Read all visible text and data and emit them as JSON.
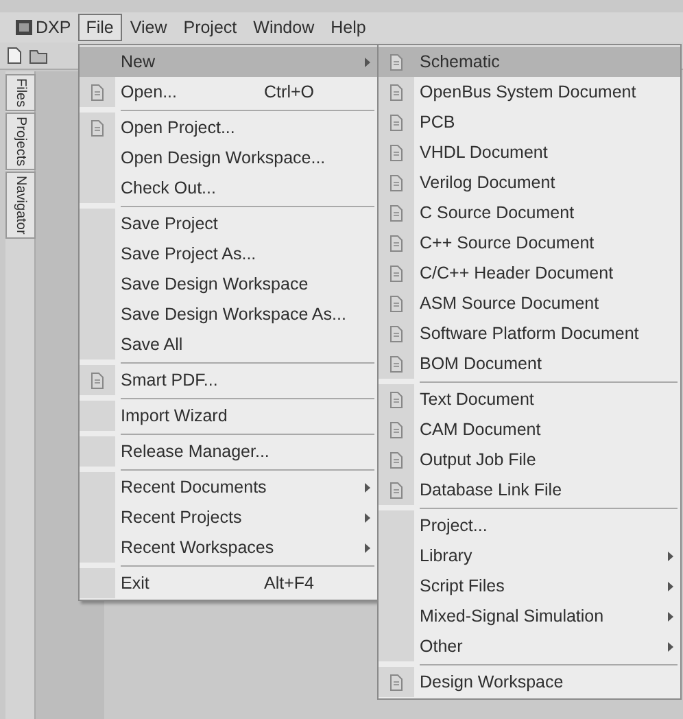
{
  "menu_bar": [
    {
      "label": "DXP",
      "kind": "logo",
      "selected": false
    },
    {
      "label": "File",
      "kind": "menu",
      "selected": true
    },
    {
      "label": "View",
      "kind": "menu",
      "selected": false
    },
    {
      "label": "Project",
      "kind": "menu",
      "selected": false
    },
    {
      "label": "Window",
      "kind": "menu",
      "selected": false
    },
    {
      "label": "Help",
      "kind": "menu",
      "selected": false
    }
  ],
  "side_tabs": [
    "Files",
    "Projects",
    "Navigator"
  ],
  "file_menu": [
    {
      "kind": "item",
      "label": "New",
      "icon": false,
      "submenu": true,
      "selected": true
    },
    {
      "kind": "item",
      "label": "Open...",
      "icon": true,
      "shortcut": "Ctrl+O",
      "submenu": false,
      "selected": false
    },
    {
      "kind": "separator"
    },
    {
      "kind": "item",
      "label": "Open Project...",
      "icon": true,
      "submenu": false,
      "selected": false
    },
    {
      "kind": "item",
      "label": "Open Design Workspace...",
      "icon": false,
      "submenu": false,
      "selected": false
    },
    {
      "kind": "item",
      "label": "Check Out...",
      "icon": false,
      "submenu": false,
      "selected": false
    },
    {
      "kind": "separator"
    },
    {
      "kind": "item",
      "label": "Save Project",
      "icon": false,
      "submenu": false,
      "selected": false
    },
    {
      "kind": "item",
      "label": "Save Project As...",
      "icon": false,
      "submenu": false,
      "selected": false
    },
    {
      "kind": "item",
      "label": "Save Design Workspace",
      "icon": false,
      "submenu": false,
      "selected": false
    },
    {
      "kind": "item",
      "label": "Save Design Workspace As...",
      "icon": false,
      "submenu": false,
      "selected": false
    },
    {
      "kind": "item",
      "label": "Save All",
      "icon": false,
      "submenu": false,
      "selected": false
    },
    {
      "kind": "separator"
    },
    {
      "kind": "item",
      "label": "Smart PDF...",
      "icon": true,
      "submenu": false,
      "selected": false
    },
    {
      "kind": "separator"
    },
    {
      "kind": "item",
      "label": "Import Wizard",
      "icon": false,
      "submenu": false,
      "selected": false
    },
    {
      "kind": "separator"
    },
    {
      "kind": "item",
      "label": "Release Manager...",
      "icon": false,
      "submenu": false,
      "selected": false
    },
    {
      "kind": "separator"
    },
    {
      "kind": "item",
      "label": "Recent Documents",
      "icon": false,
      "submenu": true,
      "selected": false
    },
    {
      "kind": "item",
      "label": "Recent Projects",
      "icon": false,
      "submenu": true,
      "selected": false
    },
    {
      "kind": "item",
      "label": "Recent Workspaces",
      "icon": false,
      "submenu": true,
      "selected": false
    },
    {
      "kind": "separator"
    },
    {
      "kind": "item",
      "label": "Exit",
      "icon": false,
      "shortcut": "Alt+F4",
      "submenu": false,
      "selected": false
    }
  ],
  "new_submenu": [
    {
      "kind": "item",
      "label": "Schematic",
      "icon": true,
      "submenu": false,
      "selected": true
    },
    {
      "kind": "item",
      "label": "OpenBus System Document",
      "icon": true,
      "submenu": false,
      "selected": false
    },
    {
      "kind": "item",
      "label": "PCB",
      "icon": true,
      "submenu": false,
      "selected": false
    },
    {
      "kind": "item",
      "label": "VHDL Document",
      "icon": true,
      "submenu": false,
      "selected": false
    },
    {
      "kind": "item",
      "label": "Verilog Document",
      "icon": true,
      "submenu": false,
      "selected": false
    },
    {
      "kind": "item",
      "label": "C Source Document",
      "icon": true,
      "submenu": false,
      "selected": false
    },
    {
      "kind": "item",
      "label": "C++ Source Document",
      "icon": true,
      "submenu": false,
      "selected": false
    },
    {
      "kind": "item",
      "label": "C/C++ Header Document",
      "icon": true,
      "submenu": false,
      "selected": false
    },
    {
      "kind": "item",
      "label": "ASM Source Document",
      "icon": true,
      "submenu": false,
      "selected": false
    },
    {
      "kind": "item",
      "label": "Software Platform Document",
      "icon": true,
      "submenu": false,
      "selected": false
    },
    {
      "kind": "item",
      "label": "BOM Document",
      "icon": true,
      "submenu": false,
      "selected": false
    },
    {
      "kind": "separator"
    },
    {
      "kind": "item",
      "label": "Text Document",
      "icon": true,
      "submenu": false,
      "selected": false
    },
    {
      "kind": "item",
      "label": "CAM Document",
      "icon": true,
      "submenu": false,
      "selected": false
    },
    {
      "kind": "item",
      "label": "Output Job File",
      "icon": true,
      "submenu": false,
      "selected": false
    },
    {
      "kind": "item",
      "label": "Database Link File",
      "icon": true,
      "submenu": false,
      "selected": false
    },
    {
      "kind": "separator"
    },
    {
      "kind": "item",
      "label": "Project...",
      "icon": false,
      "submenu": false,
      "selected": false
    },
    {
      "kind": "item",
      "label": "Library",
      "icon": false,
      "submenu": true,
      "selected": false
    },
    {
      "kind": "item",
      "label": "Script Files",
      "icon": false,
      "submenu": true,
      "selected": false
    },
    {
      "kind": "item",
      "label": "Mixed-Signal Simulation",
      "icon": false,
      "submenu": true,
      "selected": false
    },
    {
      "kind": "item",
      "label": "Other",
      "icon": false,
      "submenu": true,
      "selected": false
    },
    {
      "kind": "separator"
    },
    {
      "kind": "item",
      "label": "Design Workspace",
      "icon": true,
      "submenu": false,
      "selected": false
    }
  ]
}
